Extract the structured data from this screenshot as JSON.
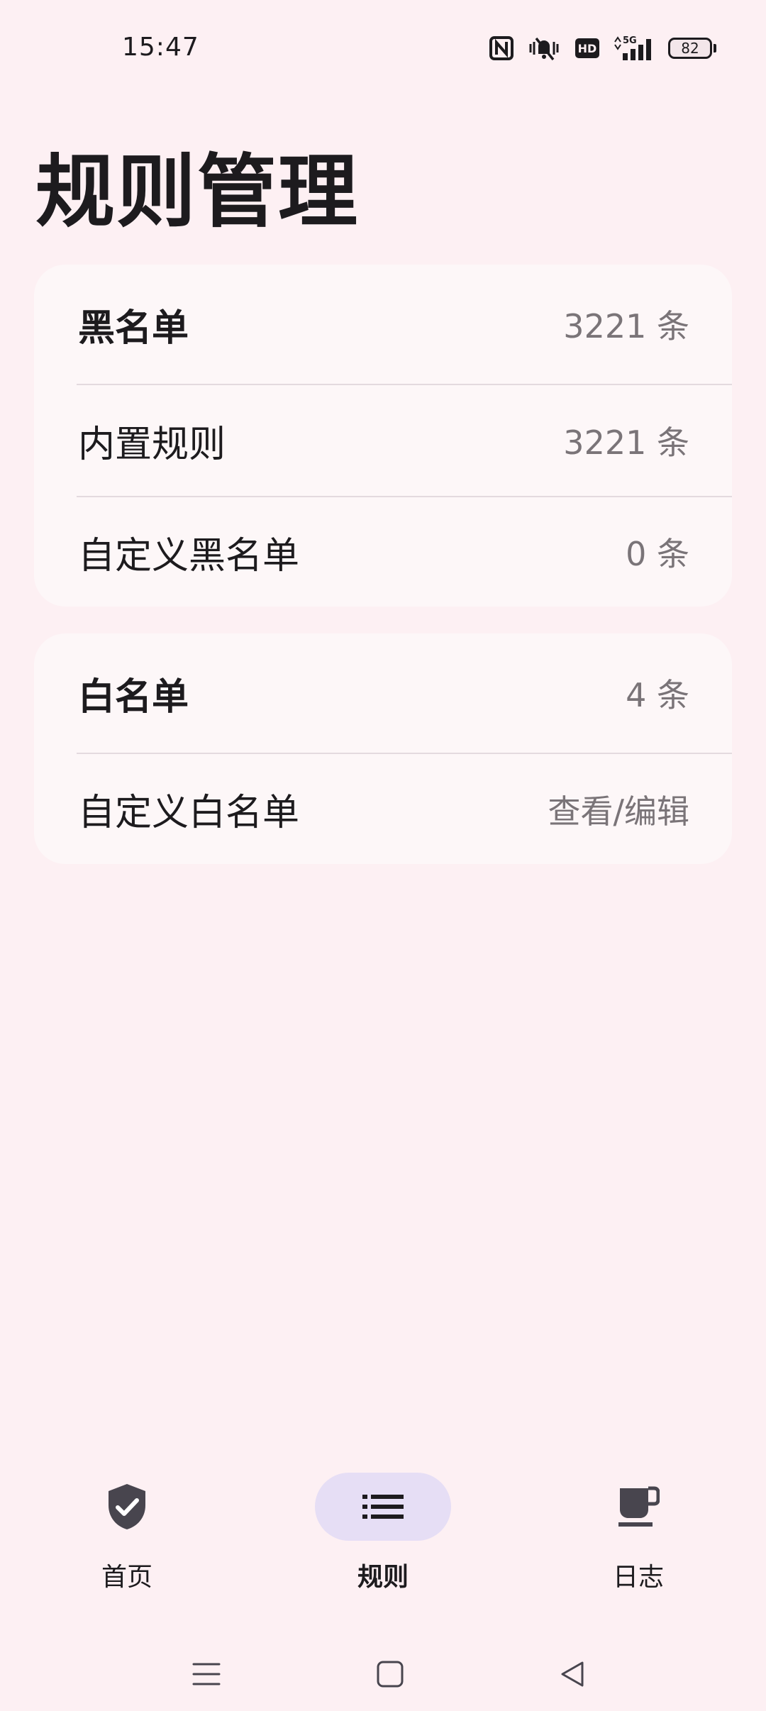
{
  "status": {
    "time": "15:47",
    "battery": "82",
    "network": "5G",
    "icons": [
      "nfc-icon",
      "mute-vibrate-icon",
      "hd-icon",
      "signal-icon",
      "battery-icon"
    ]
  },
  "page": {
    "title": "规则管理"
  },
  "blacklist": {
    "header_label": "黑名单",
    "header_value": "3221 条",
    "rows": [
      {
        "label": "内置规则",
        "value": "3221 条"
      },
      {
        "label": "自定义黑名单",
        "value": "0 条"
      }
    ]
  },
  "whitelist": {
    "header_label": "白名单",
    "header_value": "4 条",
    "rows": [
      {
        "label": "自定义白名单",
        "value": "查看/编辑"
      }
    ]
  },
  "nav": {
    "items": [
      {
        "label": "首页",
        "icon": "shield-check-icon",
        "active": false
      },
      {
        "label": "规则",
        "icon": "list-icon",
        "active": true
      },
      {
        "label": "日志",
        "icon": "cup-icon",
        "active": false
      }
    ]
  },
  "colors": {
    "background": "#fdf0f3",
    "card": "#fdf7f8",
    "active_pill": "#e6def5",
    "secondary_text": "#7a7478"
  }
}
